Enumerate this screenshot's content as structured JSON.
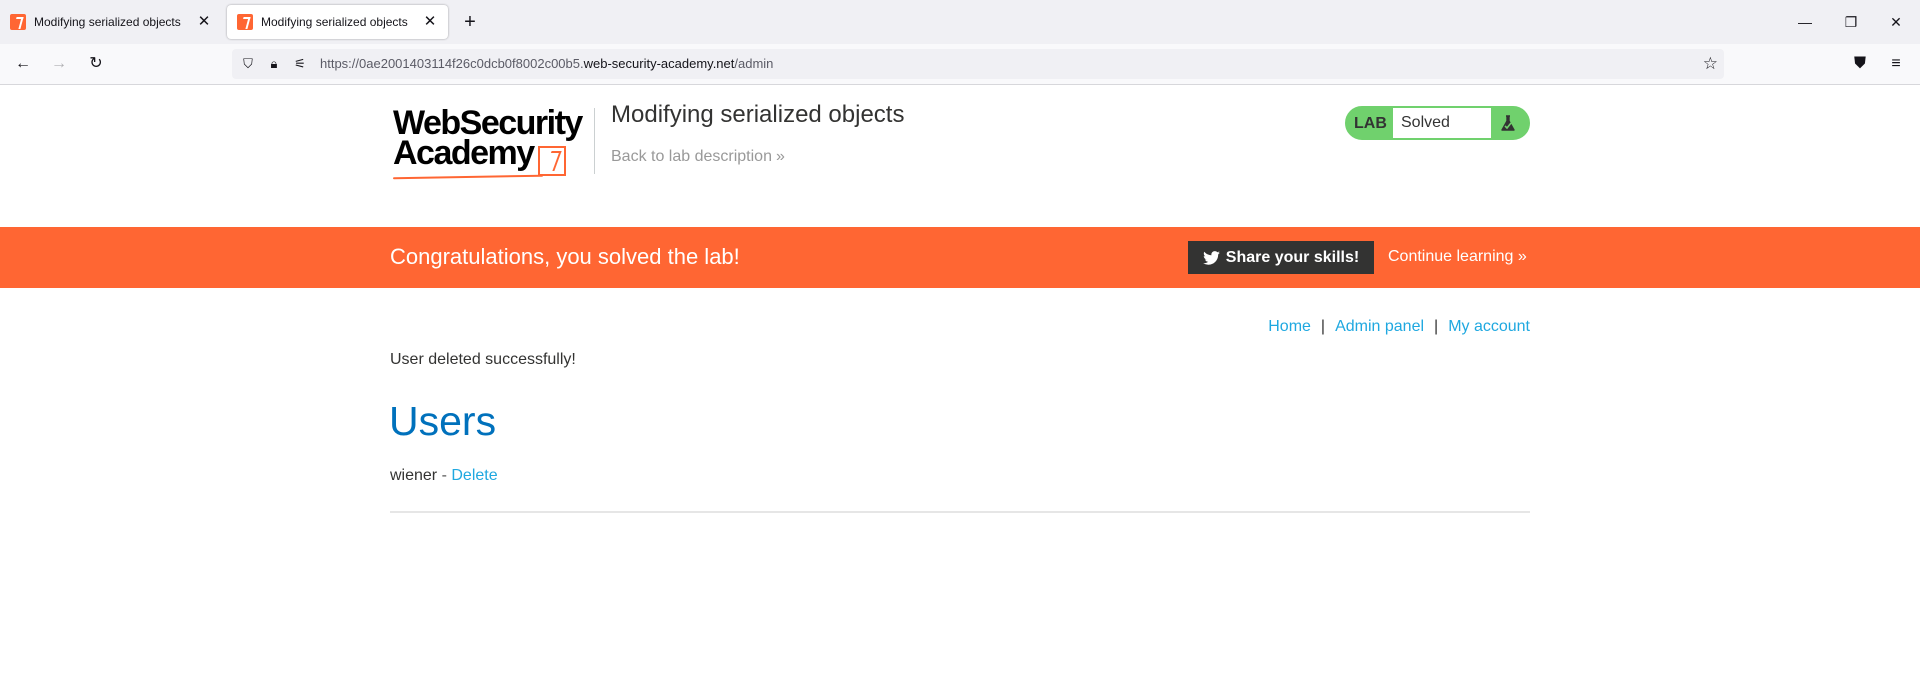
{
  "browser": {
    "tabs": [
      {
        "title": "Modifying serialized objects",
        "active": false
      },
      {
        "title": "Modifying serialized objects",
        "active": true
      }
    ],
    "url_prefix": "https://0ae2001403114f26c0dcb0f8002c00b5.",
    "url_domain": "web-security-academy.net",
    "url_path": "/admin"
  },
  "header": {
    "logo_line1": "WebSecurity",
    "logo_line2": "Academy",
    "lab_title": "Modifying serialized objects",
    "back_link": "Back to lab description",
    "lab_label": "LAB",
    "lab_status": "Solved"
  },
  "banner": {
    "message": "Congratulations, you solved the lab!",
    "share_label": "Share your skills!",
    "continue_label": "Continue learning"
  },
  "nav": {
    "home": "Home",
    "admin": "Admin panel",
    "account": "My account"
  },
  "content": {
    "message": "User deleted successfully!",
    "heading": "Users",
    "users": [
      {
        "name": "wiener",
        "separator": " - ",
        "action": "Delete"
      }
    ]
  },
  "colors": {
    "accent": "#ff6633",
    "link": "#1fa8e0",
    "heading": "#0071bc",
    "lab_solved": "#70d16d"
  }
}
